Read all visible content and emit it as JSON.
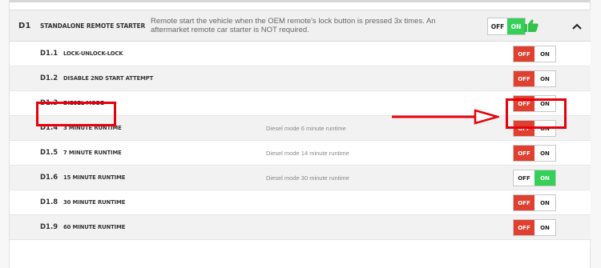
{
  "header": {
    "code": "D1",
    "name": "STANDALONE REMOTE STARTER",
    "description": "Remote start the vehicle when the OEM remote's lock button is pressed 3x times. An aftermarket remote car starter is NOT required.",
    "toggle": {
      "off_label": "OFF",
      "on_label": "ON",
      "state": "on"
    },
    "icons": {
      "thumb": "thumbs-up-icon",
      "collapse": "chevron-up-icon"
    },
    "colors": {
      "on": "#34d058",
      "off": "#e04030",
      "thumb": "#34c24a"
    }
  },
  "rows": [
    {
      "code": "D1.1",
      "name": "LOCK-UNLOCK-LOCK",
      "description": "",
      "off_label": "OFF",
      "on_label": "ON",
      "state": "off"
    },
    {
      "code": "D1.2",
      "name": "DISABLE 2ND START ATTEMPT",
      "description": "",
      "off_label": "OFF",
      "on_label": "ON",
      "state": "off"
    },
    {
      "code": "D1.3",
      "name": "DIESEL MODE",
      "description": "",
      "off_label": "OFF",
      "on_label": "ON",
      "state": "off"
    },
    {
      "code": "D1.4",
      "name": "3 MINUTE RUNTIME",
      "description": "Diesel mode 6 minute runtime",
      "off_label": "OFF",
      "on_label": "ON",
      "state": "off"
    },
    {
      "code": "D1.5",
      "name": "7 MINUTE RUNTIME",
      "description": "Diesel mode 14 minute runtime",
      "off_label": "OFF",
      "on_label": "ON",
      "state": "off"
    },
    {
      "code": "D1.6",
      "name": "15 MINUTE RUNTIME",
      "description": "Diesel mode 30 minute runtime",
      "off_label": "OFF",
      "on_label": "ON",
      "state": "on"
    },
    {
      "code": "D1.8",
      "name": "30 MINUTE RUNTIME",
      "description": "",
      "off_label": "OFF",
      "on_label": "ON",
      "state": "off"
    },
    {
      "code": "D1.9",
      "name": "60 MINUTE RUNTIME",
      "description": "",
      "off_label": "OFF",
      "on_label": "ON",
      "state": "off"
    }
  ],
  "annotations": {
    "highlight_color": "#e8000b",
    "highlighted_row": "D1.3"
  }
}
